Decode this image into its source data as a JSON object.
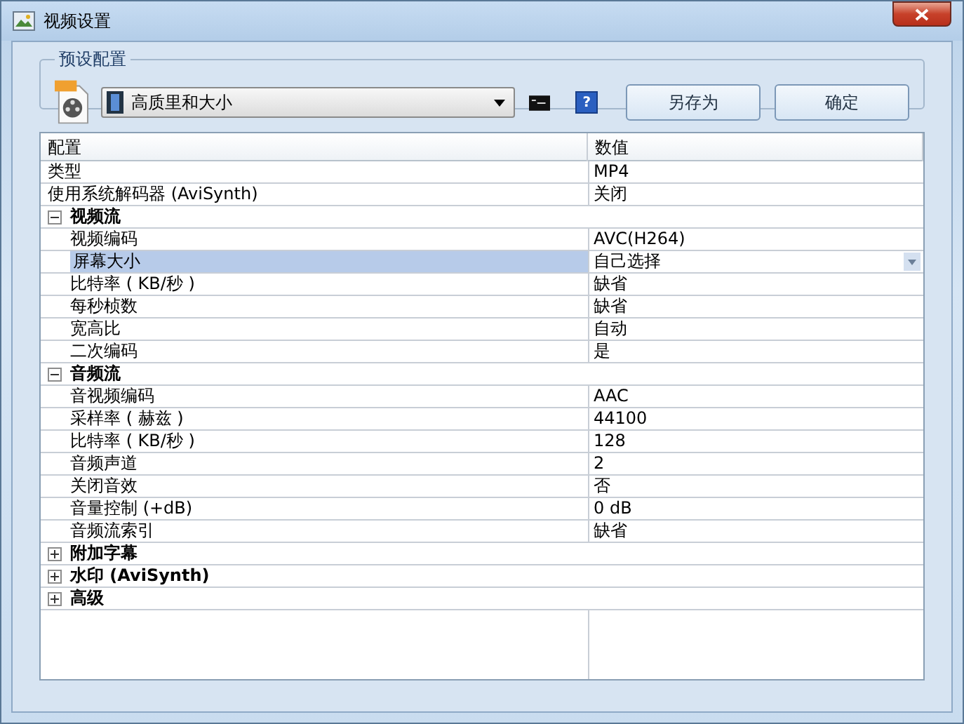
{
  "window": {
    "title": "视频设置"
  },
  "preset": {
    "legend": "预设配置",
    "profile": "高质里和大小",
    "buttons": [
      "另存为",
      "确定"
    ],
    "help": "?"
  },
  "table": {
    "columns": [
      "配置",
      "数值"
    ],
    "rows": [
      {
        "kind": "property",
        "name": "类型",
        "value": "MP4",
        "selected": false
      },
      {
        "kind": "property",
        "name": "使用系统解码器 (AviSynth)",
        "value": "关闭",
        "selected": false
      },
      {
        "kind": "category",
        "name": "视频流",
        "expanded": true,
        "children": [
          {
            "kind": "property",
            "name": "视频编码",
            "value": "AVC(H264)",
            "selected": false
          },
          {
            "kind": "property",
            "name": "屏幕大小",
            "value": "自己选择",
            "selected": true
          },
          {
            "kind": "property",
            "name": "比特率 ( KB/秒 )",
            "value": "缺省",
            "selected": false
          },
          {
            "kind": "property",
            "name": "每秒桢数",
            "value": "缺省",
            "selected": false
          },
          {
            "kind": "property",
            "name": "宽高比",
            "value": "自动",
            "selected": false
          },
          {
            "kind": "property",
            "name": "二次编码",
            "value": "是",
            "selected": false
          }
        ]
      },
      {
        "kind": "category",
        "name": "音频流",
        "expanded": true,
        "children": [
          {
            "kind": "property",
            "name": "音视频编码",
            "value": "AAC",
            "selected": false
          },
          {
            "kind": "property",
            "name": "采样率 ( 赫兹 )",
            "value": "44100",
            "selected": false
          },
          {
            "kind": "property",
            "name": "比特率 ( KB/秒 )",
            "value": "128",
            "selected": false
          },
          {
            "kind": "property",
            "name": "音频声道",
            "value": "2",
            "selected": false
          },
          {
            "kind": "property",
            "name": "关闭音效",
            "value": "否",
            "selected": false
          },
          {
            "kind": "property",
            "name": "音量控制 (+dB)",
            "value": "0 dB",
            "selected": false
          },
          {
            "kind": "property",
            "name": "音频流索引",
            "value": "缺省",
            "selected": false
          }
        ]
      },
      {
        "kind": "category",
        "name": "附加字幕",
        "expanded": false
      },
      {
        "kind": "category",
        "name": "水印 (AviSynth)",
        "expanded": false
      },
      {
        "kind": "category",
        "name": "高级",
        "expanded": false
      }
    ]
  }
}
